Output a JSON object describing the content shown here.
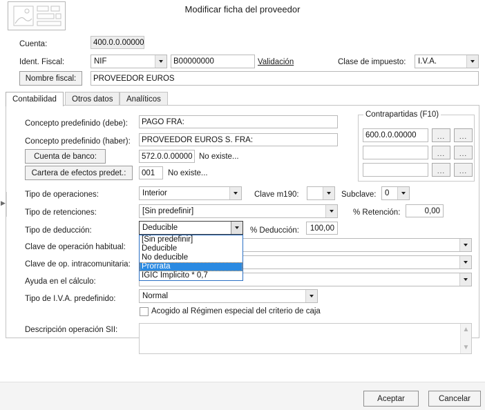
{
  "window": {
    "title": "Modificar ficha del proveedor",
    "header_icon": "form-layout-icon"
  },
  "top_form": {
    "cuenta_label": "Cuenta:",
    "cuenta_value": "400.0.0.00000",
    "ident_fiscal_label": "Ident. Fiscal:",
    "ident_fiscal_type": "NIF",
    "ident_fiscal_value": "B00000000",
    "validacion_link": "Validación",
    "clase_impuesto_label": "Clase de impuesto:",
    "clase_impuesto_value": "I.V.A.",
    "nombre_fiscal_button": "Nombre fiscal:",
    "nombre_fiscal_value": "PROVEEDOR EUROS"
  },
  "tabs": [
    {
      "label": "Contabilidad",
      "selected": true
    },
    {
      "label": "Otros datos",
      "selected": false
    },
    {
      "label": "Analíticos",
      "selected": false
    }
  ],
  "contabilidad": {
    "concepto_debe_label": "Concepto predefinido (debe):",
    "concepto_debe_value": "PAGO FRA:",
    "concepto_haber_label": "Concepto predefinido (haber):",
    "concepto_haber_value": "PROVEEDOR EUROS S. FRA:",
    "cuenta_banco_button": "Cuenta de banco:",
    "cuenta_banco_value": "572.0.0.00000",
    "cuenta_banco_note": "No existe...",
    "cartera_button": "Cartera de efectos predet.:",
    "cartera_value": "001",
    "cartera_note": "No existe...",
    "tipo_operaciones_label": "Tipo de operaciones:",
    "tipo_operaciones_value": "Interior",
    "clave_m190_label": "Clave m190:",
    "clave_m190_value": "",
    "subclave_label": "Subclave:",
    "subclave_value": "0",
    "tipo_retenciones_label": "Tipo de retenciones:",
    "tipo_retenciones_value": "[Sin predefinir]",
    "pct_retencion_label": "% Retención:",
    "pct_retencion_value": "0,00",
    "tipo_deduccion_label": "Tipo de deducción:",
    "tipo_deduccion_value": "Deducible",
    "pct_deduccion_label": "% Deducción:",
    "pct_deduccion_value": "100,00",
    "clave_op_habitual_label": "Clave de operación habitual:",
    "clave_op_habitual_value": "",
    "clave_op_intra_label": "Clave de op. intracomunitaria:",
    "clave_op_intra_value": "",
    "ayuda_calculo_label": "Ayuda en el cálculo:",
    "ayuda_calculo_value": "",
    "tipo_iva_label": "Tipo de I.V.A. predefinido:",
    "tipo_iva_value": "Normal",
    "criterio_caja_label": "Acogido al Régimen especial del criterio de caja",
    "criterio_caja_checked": false,
    "descripcion_sii_label": "Descripción operación SII:",
    "descripcion_sii_value": ""
  },
  "tipo_deduccion_dropdown": {
    "open": true,
    "options": [
      "[Sin predefinir]",
      "Deducible",
      "No deducible",
      "Prorrata",
      "IGIC Implicito * 0,7"
    ],
    "highlighted_index": 3,
    "highlight_color": "#2a8ae2"
  },
  "contrapartidas": {
    "title": "Contrapartidas (F10)",
    "rows": [
      {
        "value": "600.0.0.00000",
        "btn1": "...",
        "btn2": "..."
      },
      {
        "value": "",
        "btn1": "...",
        "btn2": "..."
      },
      {
        "value": "",
        "btn1": "...",
        "btn2": "..."
      }
    ]
  },
  "footer": {
    "accept_label": "Aceptar",
    "cancel_label": "Cancelar"
  }
}
